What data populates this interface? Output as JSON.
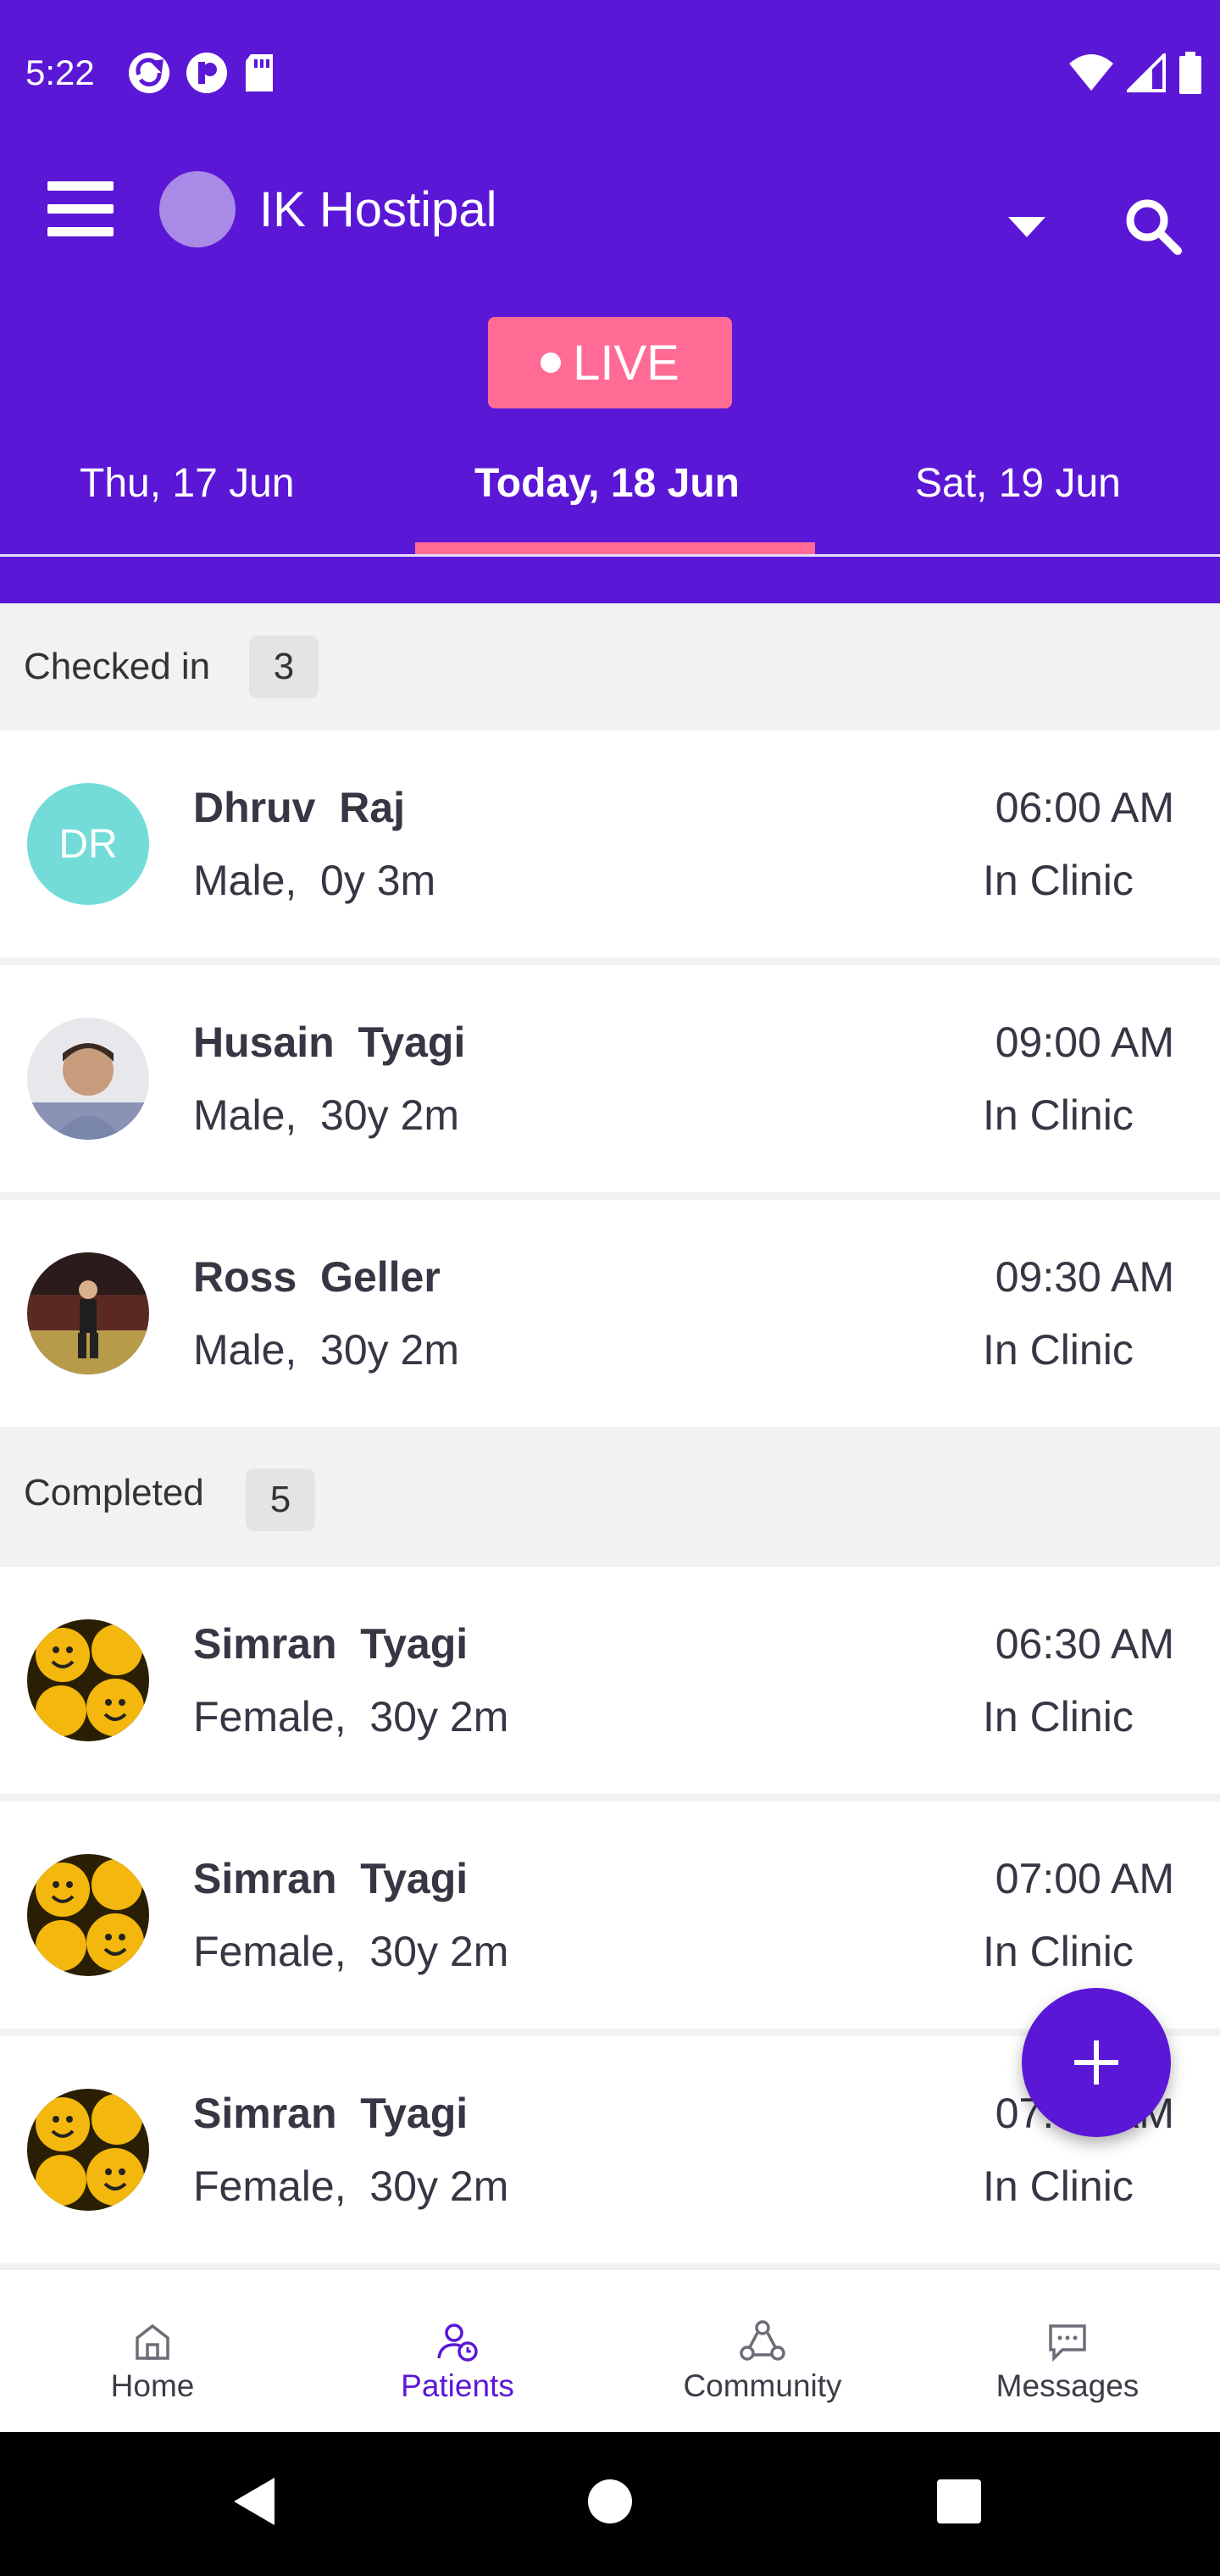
{
  "status_bar": {
    "time": "5:22"
  },
  "header": {
    "hospital_name": "IK Hostipal",
    "live_label": "LIVE"
  },
  "date_tabs": {
    "prev": "Thu, 17 Jun",
    "today": "Today, 18 Jun",
    "next": "Sat, 19 Jun"
  },
  "sections": {
    "checked_in": {
      "label": "Checked in",
      "count": "3",
      "patients": [
        {
          "initials": "DR",
          "name": "Dhruv  Raj",
          "info": "Male,  0y 3m",
          "time": "06:00 AM",
          "location": "In Clinic"
        },
        {
          "name": "Husain  Tyagi",
          "info": "Male,  30y 2m",
          "time": "09:00 AM",
          "location": "In Clinic"
        },
        {
          "name": "Ross  Geller",
          "info": "Male,  30y 2m",
          "time": "09:30 AM",
          "location": "In Clinic"
        }
      ]
    },
    "completed": {
      "label": "Completed",
      "count": "5",
      "patients": [
        {
          "name": "Simran  Tyagi",
          "info": "Female,  30y 2m",
          "time": "06:30 AM",
          "location": "In Clinic"
        },
        {
          "name": "Simran  Tyagi",
          "info": "Female,  30y 2m",
          "time": "07:00 AM",
          "location": "In Clinic"
        },
        {
          "name": "Simran  Tyagi",
          "info": "Female,  30y 2m",
          "time": "07:30 AM",
          "location": "In Clinic"
        }
      ]
    }
  },
  "bottom_nav": {
    "home": "Home",
    "patients": "Patients",
    "community": "Community",
    "messages": "Messages",
    "active": "patients"
  },
  "colors": {
    "primary": "#5b17d6",
    "live": "#ff6b95",
    "initials_avatar": "#73dcd9"
  }
}
